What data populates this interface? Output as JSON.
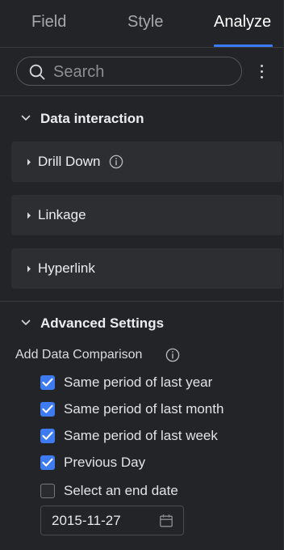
{
  "tabs": [
    {
      "label": "Field",
      "active": false
    },
    {
      "label": "Style",
      "active": false
    },
    {
      "label": "Analyze",
      "active": true
    }
  ],
  "search": {
    "placeholder": "Search",
    "value": ""
  },
  "data_interaction": {
    "title": "Data interaction",
    "expanded": true,
    "items": [
      {
        "label": "Drill Down",
        "has_info_icon": true
      },
      {
        "label": "Linkage",
        "has_info_icon": false
      },
      {
        "label": "Hyperlink",
        "has_info_icon": false
      }
    ]
  },
  "advanced": {
    "title": "Advanced Settings",
    "expanded": true,
    "comparison_label": "Add Data Comparison",
    "options": [
      {
        "label": "Same period of last year",
        "checked": true
      },
      {
        "label": "Same period of last month",
        "checked": true
      },
      {
        "label": "Same period of last week",
        "checked": true
      },
      {
        "label": "Previous Day",
        "checked": true
      },
      {
        "label": "Select an end date",
        "checked": false
      }
    ],
    "end_date": "2015-11-27"
  },
  "colors": {
    "background": "#232427",
    "card": "#2d2e32",
    "accent": "#3a7af2",
    "checkbox_on": "#3e7bf0"
  }
}
